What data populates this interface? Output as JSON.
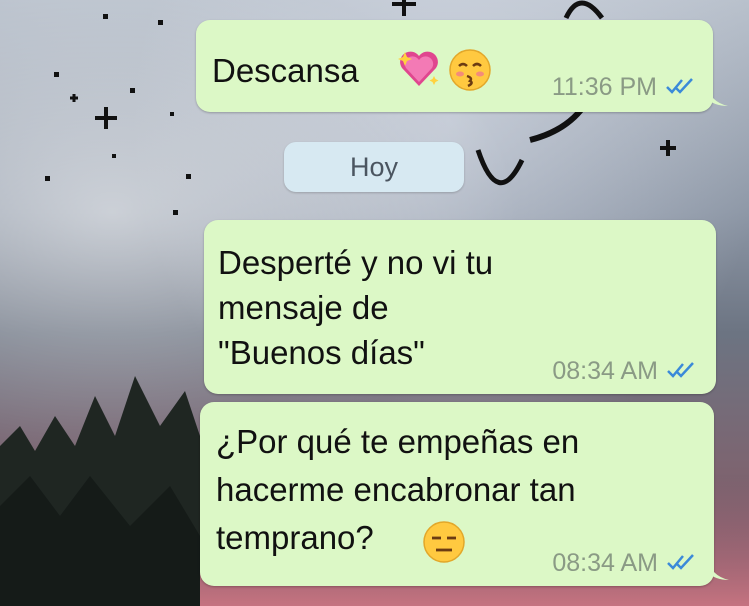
{
  "chat": {
    "date_separator": "Hoy",
    "messages": [
      {
        "text": "Descansa",
        "emojis": [
          "sparkling-heart-emoji",
          "kissing-face-closed-eyes-emoji"
        ],
        "time": "11:36 PM",
        "status": "read"
      },
      {
        "text": "Desperté y no vi tu\nmensaje de\n\"Buenos días\"",
        "time": "08:34 AM",
        "status": "read"
      },
      {
        "text": "¿Por qué te empeñas en\nhacerme encabronar tan\ntemprano?",
        "emojis": [
          "expressionless-face-emoji"
        ],
        "time": "08:34 AM",
        "status": "read"
      }
    ]
  },
  "colors": {
    "bubble_outgoing": "#dcf8c6",
    "date_chip": "#d7e9f2",
    "read_ticks": "#3b8ad9",
    "timestamp": "#8a9a85"
  }
}
